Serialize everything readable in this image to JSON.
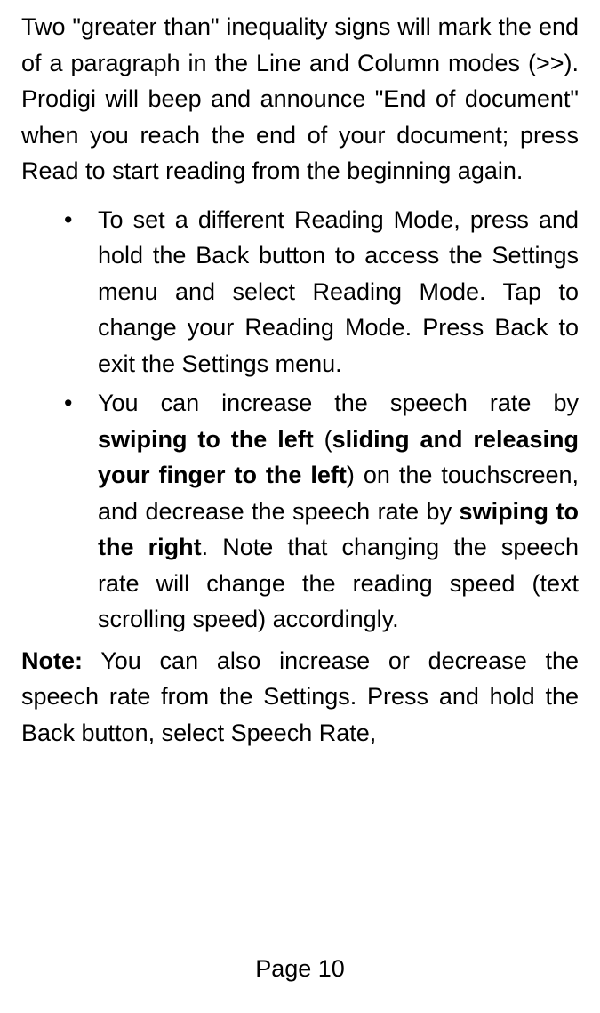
{
  "intro_paragraph": "Two \"greater than\" inequality signs will mark the end of a paragraph in the Line and Column modes (>>). Prodigi will beep and announce \"End of document\" when you reach the end of your document; press Read to start reading from the beginning again.",
  "bullets": {
    "item1": "To set a different Reading Mode, press and hold the Back button to access the Settings menu and select Reading Mode. Tap to change your Reading Mode. Press Back to exit the Settings menu.",
    "item2": {
      "part1": "You can increase the speech rate by ",
      "bold1": "swiping to the left",
      "part2": " (",
      "bold2": "sliding and releasing your finger to the left",
      "part3": ") on the touchscreen, and decrease the speech rate by ",
      "bold3": "swiping to the right",
      "part4": ". Note that changing the speech rate will change the reading speed (text scrolling speed) accordingly."
    }
  },
  "note": {
    "label": "Note:",
    "text": " You can also increase or decrease the speech rate from the Settings. Press and hold the Back button, select Speech Rate,"
  },
  "footer": "Page 10"
}
